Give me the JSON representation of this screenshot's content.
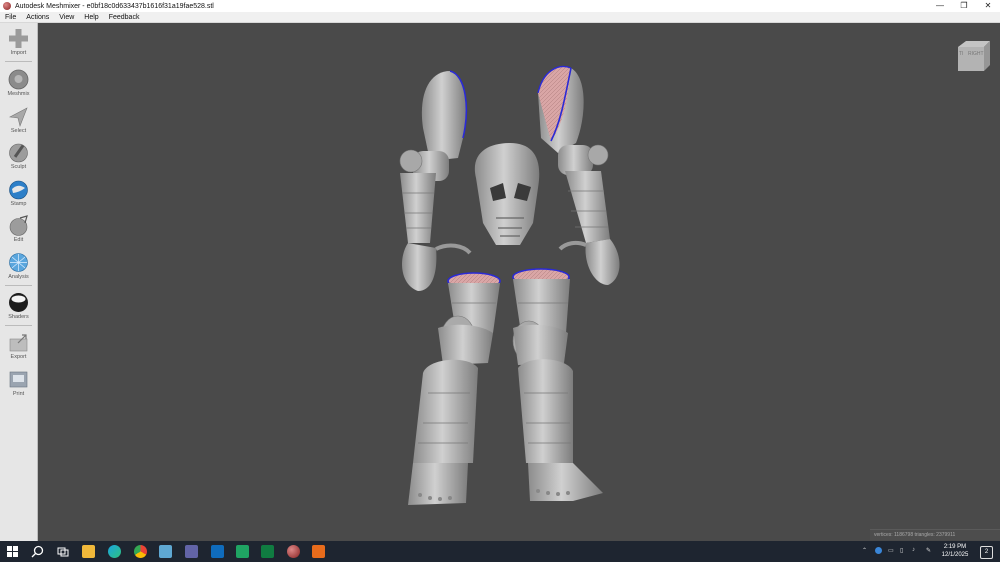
{
  "window": {
    "title": "Autodesk Meshmixer - e0bf18c0d633437b1616f31a19fae528.stl",
    "controls": [
      "—",
      "❐",
      "✕"
    ]
  },
  "menu": [
    "File",
    "Actions",
    "View",
    "Help",
    "Feedback"
  ],
  "toolbar": {
    "tools": [
      {
        "label": "Import",
        "icon": "plus-icon"
      },
      {
        "label": "Meshmix",
        "icon": "meshmix-sphere-icon"
      },
      {
        "label": "Select",
        "icon": "select-arrow-icon"
      },
      {
        "label": "Sculpt",
        "icon": "sculpt-brush-icon"
      },
      {
        "label": "Stamp",
        "icon": "stamp-icon"
      },
      {
        "label": "Edit",
        "icon": "edit-icon"
      },
      {
        "label": "Analysis",
        "icon": "analysis-icon"
      },
      {
        "label": "Shaders",
        "icon": "shader-sphere-icon"
      },
      {
        "label": "Export",
        "icon": "export-folder-icon"
      },
      {
        "label": "Print",
        "icon": "print-icon"
      }
    ]
  },
  "viewcube": {
    "face_label": "RIGHT",
    "corner_label": "TI"
  },
  "status": {
    "text": "vertices: 1186798 triangles: 2379911"
  },
  "taskbar": {
    "time": "2:19 PM",
    "date": "12/1/2025",
    "notification_count": "2",
    "apps": [
      "start-icon",
      "search-icon",
      "task-view-icon",
      "file-explorer-icon",
      "edge-icon",
      "chrome-icon",
      "app-icon",
      "teams-icon",
      "outlook-icon",
      "sheets-icon",
      "excel-icon",
      "meshmixer-icon",
      "office-icon"
    ]
  },
  "colors": {
    "viewport_bg": "#4a4a4a",
    "model_gray": "#b9b9b9",
    "selection_outline": "#2a2ad6",
    "open_surface_pink": "#d9a6a6",
    "taskbar_bg": "#1e2530"
  }
}
